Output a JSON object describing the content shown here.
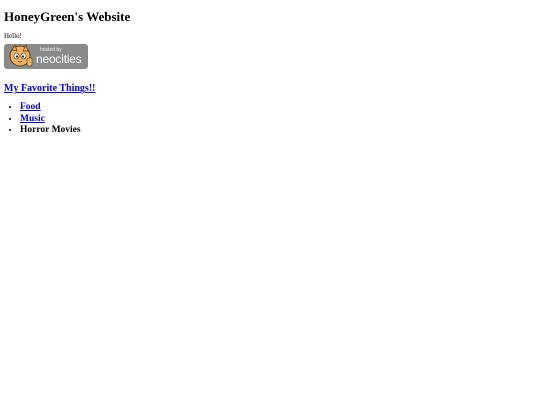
{
  "page": {
    "title": "HoneyGreen's Website",
    "greeting": "Hello!"
  },
  "badge": {
    "line1": "hosted by",
    "line2": "neocities",
    "icon": "neocities-cat-icon",
    "color": "#8a8a8a"
  },
  "section": {
    "link_text": "My Favorite Things!!"
  },
  "favorites": [
    {
      "label": "Food",
      "is_link": true
    },
    {
      "label": "Music",
      "is_link": true
    },
    {
      "label": "Horror Movies",
      "is_link": false
    }
  ],
  "colors": {
    "link": "#0000ee",
    "text": "#000000",
    "background": "#ffffff"
  }
}
